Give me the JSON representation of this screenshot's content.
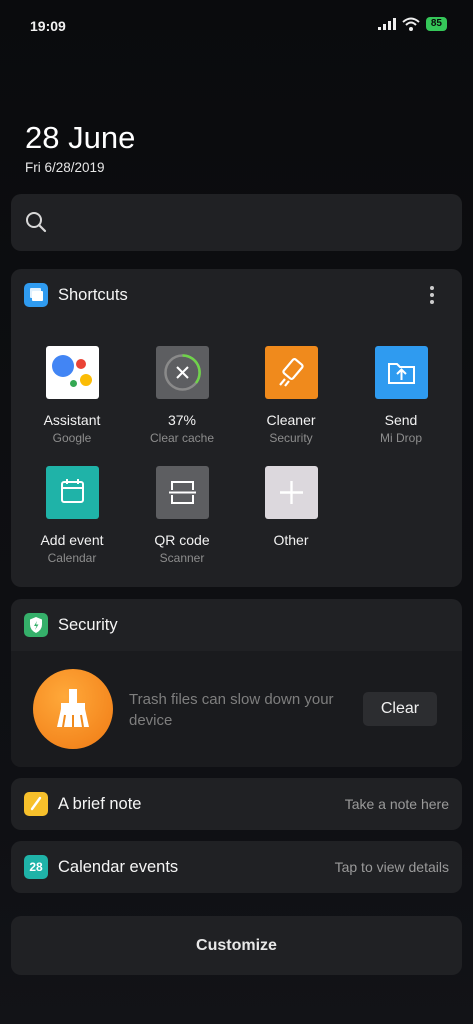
{
  "status": {
    "time": "19:09",
    "battery": "85"
  },
  "date": {
    "big": "28 June",
    "sub": "Fri 6/28/2019"
  },
  "shortcuts": {
    "title": "Shortcuts",
    "items": [
      {
        "label": "Assistant",
        "sub": "Google"
      },
      {
        "label": "37%",
        "sub": "Clear cache"
      },
      {
        "label": "Cleaner",
        "sub": "Security"
      },
      {
        "label": "Send",
        "sub": "Mi Drop"
      },
      {
        "label": "Add event",
        "sub": "Calendar"
      },
      {
        "label": "QR code",
        "sub": "Scanner"
      },
      {
        "label": "Other",
        "sub": ""
      }
    ]
  },
  "security": {
    "title": "Security",
    "message": "Trash files can slow down your device",
    "button": "Clear"
  },
  "note": {
    "title": "A brief note",
    "hint": "Take a note here"
  },
  "calendar": {
    "title": "Calendar events",
    "hint": "Tap to view details",
    "day": "28"
  },
  "customize": "Customize",
  "colors": {
    "accent_blue": "#2f9bf0",
    "accent_green": "#35c759",
    "accent_orange": "#f08a1c",
    "accent_teal": "#1fb3a8",
    "accent_yellow": "#f7c02b"
  }
}
